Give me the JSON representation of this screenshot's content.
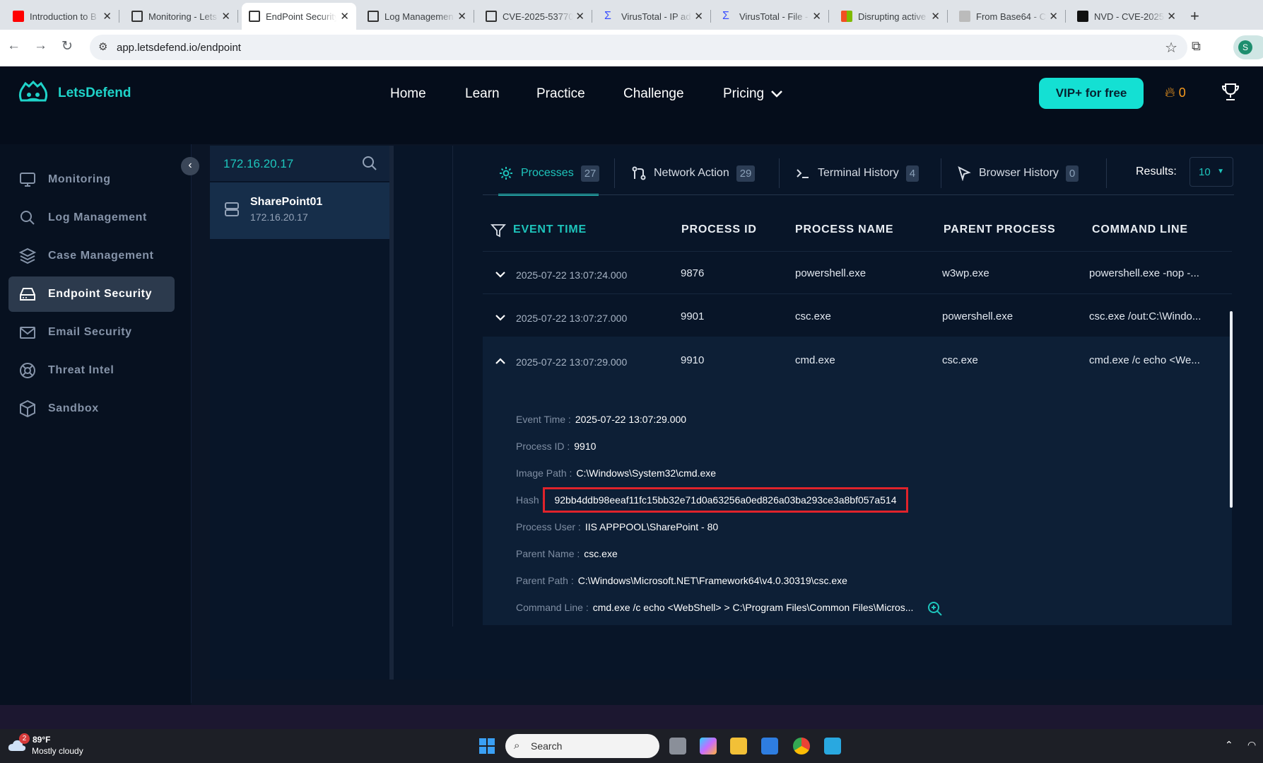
{
  "browser": {
    "tabs": [
      {
        "title": "Introduction to B",
        "icon_color": "#ff0000"
      },
      {
        "title": "Monitoring - Lets",
        "icon_color": "#333333"
      },
      {
        "title": "EndPoint Security",
        "icon_color": "#333333"
      },
      {
        "title": "Log Managemen",
        "icon_color": "#333333"
      },
      {
        "title": "CVE-2025-53770",
        "icon_color": "#333333"
      },
      {
        "title": "VirusTotal - IP ad",
        "icon_color": "#394eff"
      },
      {
        "title": "VirusTotal - File -",
        "icon_color": "#394eff"
      },
      {
        "title": "Disrupting active",
        "icon_color": "#f25022"
      },
      {
        "title": "From Base64 - Cy",
        "icon_color": "#aaaaaa"
      },
      {
        "title": "NVD - CVE-2025",
        "icon_color": "#111111"
      }
    ],
    "url": "app.letsdefend.io/endpoint",
    "profile_initial": "S"
  },
  "header": {
    "brand": "LetsDefend",
    "nav": [
      "Home",
      "Learn",
      "Practice",
      "Challenge",
      "Pricing"
    ],
    "vip_label": "VIP+ for free",
    "streak_count": "0"
  },
  "sidebar": {
    "items": [
      {
        "label": "Monitoring",
        "icon": "monitor-icon"
      },
      {
        "label": "Log Management",
        "icon": "search-icon"
      },
      {
        "label": "Case Management",
        "icon": "layers-icon"
      },
      {
        "label": "Endpoint Security",
        "icon": "hard-drive-icon",
        "active": true
      },
      {
        "label": "Email Security",
        "icon": "mail-icon"
      },
      {
        "label": "Threat Intel",
        "icon": "lifebuoy-icon"
      },
      {
        "label": "Sandbox",
        "icon": "box-icon"
      }
    ]
  },
  "hosts": {
    "search_value": "172.16.20.17",
    "selected": {
      "name": "SharePoint01",
      "ip": "172.16.20.17"
    }
  },
  "tabs": [
    {
      "label": "Processes",
      "count": "27",
      "icon": "gear-icon"
    },
    {
      "label": "Network Action",
      "count": "29",
      "icon": "network-icon"
    },
    {
      "label": "Terminal History",
      "count": "4",
      "icon": "terminal-icon"
    },
    {
      "label": "Browser History",
      "count": "0",
      "icon": "cursor-icon"
    }
  ],
  "results": {
    "label": "Results:",
    "value": "10"
  },
  "table": {
    "columns": [
      "EVENT TIME",
      "PROCESS ID",
      "PROCESS NAME",
      "PARENT PROCESS",
      "COMMAND LINE"
    ],
    "rows": [
      {
        "time": "2025-07-22 13:07:24.000",
        "pid": "9876",
        "name": "powershell.exe",
        "parent": "w3wp.exe",
        "cmd": "powershell.exe -nop -..."
      },
      {
        "time": "2025-07-22 13:07:27.000",
        "pid": "9901",
        "name": "csc.exe",
        "parent": "powershell.exe",
        "cmd": "csc.exe /out:C:\\Windo..."
      },
      {
        "time": "2025-07-22 13:07:29.000",
        "pid": "9910",
        "name": "cmd.exe",
        "parent": "csc.exe",
        "cmd": "cmd.exe /c echo <We..."
      }
    ]
  },
  "details": {
    "event_time": {
      "label": "Event Time :",
      "value": "2025-07-22 13:07:29.000"
    },
    "process_id": {
      "label": "Process ID :",
      "value": "9910"
    },
    "image_path": {
      "label": "Image Path :",
      "value": "C:\\Windows\\System32\\cmd.exe"
    },
    "hash": {
      "label": "Hash :",
      "value": "92bb4ddb98eeaf11fc15bb32e71d0a63256a0ed826a03ba293ce3a8bf057a514"
    },
    "process_user": {
      "label": "Process User :",
      "value": "IIS APPPOOL\\SharePoint - 80"
    },
    "parent_name": {
      "label": "Parent Name :",
      "value": "csc.exe"
    },
    "parent_path": {
      "label": "Parent Path :",
      "value": "C:\\Windows\\Microsoft.NET\\Framework64\\v4.0.30319\\csc.exe"
    },
    "command_line": {
      "label": "Command Line :",
      "value": "cmd.exe /c echo <WebShell> > C:\\Program Files\\Common Files\\Micros..."
    }
  },
  "taskbar": {
    "weather_temp": "89°F",
    "weather_cond": "Mostly cloudy",
    "weather_badge": "2",
    "search_label": "Search"
  },
  "colors": {
    "accent": "#1ec5bc",
    "vip": "#14e0d3",
    "highlight": "#e0232b"
  }
}
